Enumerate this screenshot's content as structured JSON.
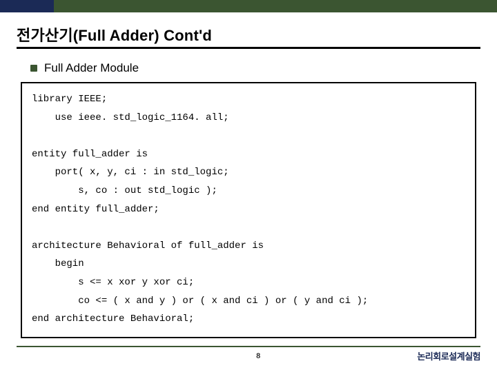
{
  "header": {
    "title": "전가산기(Full Adder) Cont'd"
  },
  "bullet": {
    "label": "Full Adder Module"
  },
  "code": {
    "l1": "library IEEE;",
    "l2": "    use ieee. std_logic_1164. all;",
    "l3": "",
    "l4": "entity full_adder is",
    "l5": "    port( x, y, ci : in std_logic;",
    "l6": "        s, co : out std_logic );",
    "l7": "end entity full_adder;",
    "l8": "",
    "l9": "architecture Behavioral of full_adder is",
    "l10": "    begin",
    "l11": "        s <= x xor y xor ci;",
    "l12": "        co <= ( x and y ) or ( x and ci ) or ( y and ci );",
    "l13": "end architecture Behavioral;"
  },
  "footer": {
    "page": "8",
    "label": "논리회로설계실험"
  }
}
